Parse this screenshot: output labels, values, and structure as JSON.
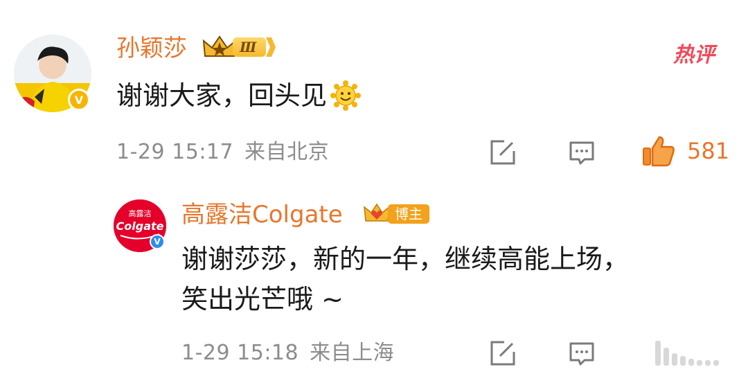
{
  "comment": {
    "author": "孙颖莎",
    "level_badge": "Ⅲ",
    "hot_tag": "热评",
    "text": "谢谢大家，回头见",
    "emoji": "smile-sun-icon",
    "date": "1-29",
    "time": "15:17",
    "location": "来自北京",
    "likes": "581"
  },
  "reply": {
    "author": "高露洁Colgate",
    "blogger_tag": "博主",
    "avatar_text_top": "高露洁",
    "avatar_text_brand": "Colgate",
    "text_line1": "谢谢莎莎，新的一年，继续高能上场，",
    "text_line2": "笑出光芒哦 ~",
    "date": "1-29",
    "time": "15:18",
    "location": "来自上海"
  },
  "colors": {
    "name": "#e8762b",
    "meta": "#8c8c8c",
    "hot": "#f04a5a",
    "colgate_red": "#e4002b"
  }
}
